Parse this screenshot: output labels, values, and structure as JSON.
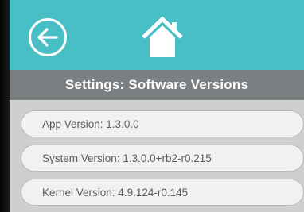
{
  "colors": {
    "topbar": "#47bfc4",
    "titlebar": "#7c7f82",
    "row_bg": "#f1f1ef",
    "row_text": "#5a5d60"
  },
  "nav": {
    "back_icon": "arrow-left-circle",
    "home_icon": "house"
  },
  "header": {
    "title": "Settings: Software Versions"
  },
  "versions": [
    {
      "label": "App Version: 1.3.0.0"
    },
    {
      "label": "System Version: 1.3.0.0+rb2-r0.215"
    },
    {
      "label": "Kernel Version: 4.9.124-r0.145"
    }
  ]
}
